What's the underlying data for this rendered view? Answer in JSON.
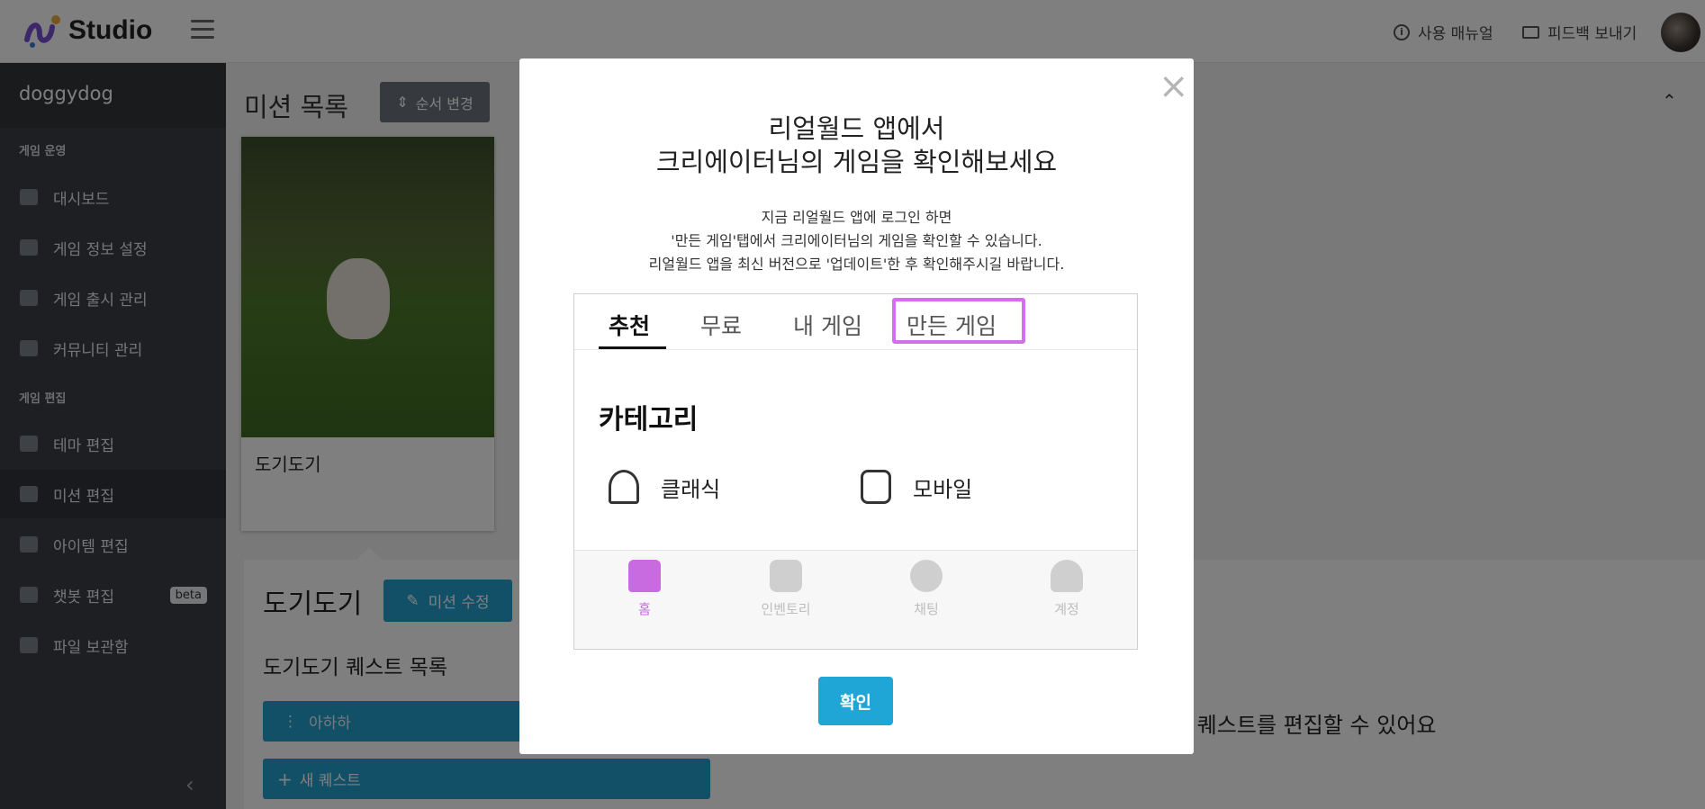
{
  "header": {
    "logo_text": "Studio",
    "manual_label": "사용 매뉴얼",
    "feedback_label": "피드백 보내기"
  },
  "sidebar": {
    "title": "doggydog",
    "section_ops": "게임 운영",
    "section_edit": "게임 편집",
    "items": [
      {
        "label": "대시보드"
      },
      {
        "label": "게임 정보 설정"
      },
      {
        "label": "게임 출시 관리"
      },
      {
        "label": "커뮤니티 관리"
      },
      {
        "label": "테마 편집"
      },
      {
        "label": "미션 편집"
      },
      {
        "label": "아이템 편집"
      },
      {
        "label": "챗봇 편집",
        "badge": "beta"
      },
      {
        "label": "파일 보관함"
      }
    ]
  },
  "content": {
    "page_title": "미션 목록",
    "order_button": "순서 변경",
    "card_title": "도기도기",
    "panel_title": "도기도기",
    "edit_button": "미션 수정",
    "quest_list_title": "도기도기 퀘스트 목록",
    "quest_item": "아하하",
    "new_quest": "새 퀘스트",
    "hint": "션 퀘스트를 편집할 수 있어요"
  },
  "modal": {
    "close": "×",
    "title_line1": "리얼월드 앱에서",
    "title_line2": "크리에이터님의 게임을 확인해보세요",
    "desc_line1": "지금 리얼월드 앱에 로그인 하면",
    "desc_line2": "'만든 게임'탭에서 크리에이터님의 게임을 확인할 수 있습니다.",
    "desc_line3": "리얼월드 앱을 최신 버전으로 '업데이트'한 후 확인해주시길 바랍니다.",
    "mock": {
      "tabs": [
        "추천",
        "무료",
        "내 게임",
        "만든 게임"
      ],
      "category_title": "카테고리",
      "categories": [
        "클래식",
        "모바일"
      ],
      "nav": [
        "홈",
        "인벤토리",
        "채팅",
        "계정"
      ]
    },
    "confirm": "확인"
  },
  "colors": {
    "accent": "#25a0d0",
    "highlight": "#d36fea",
    "sidebar_bg": "#3a3f44"
  }
}
